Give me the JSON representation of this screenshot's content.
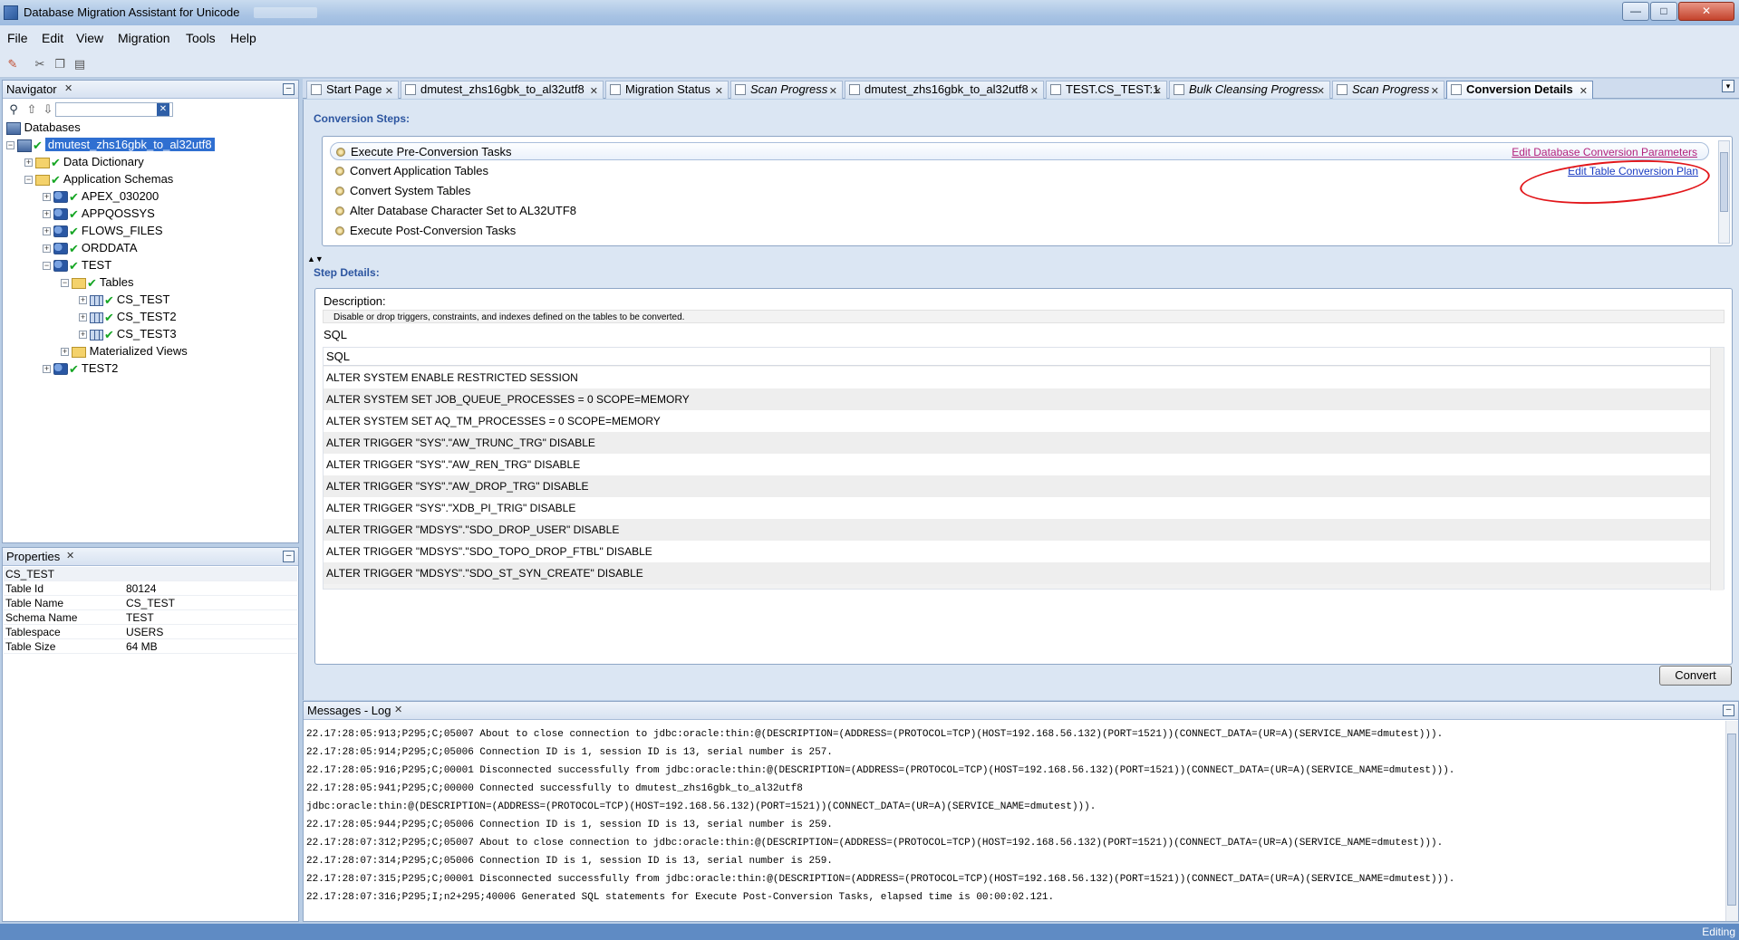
{
  "window": {
    "title": "Database Migration Assistant for Unicode",
    "minimize": "—",
    "maximize": "□",
    "close": "✕"
  },
  "menu": [
    "File",
    "Edit",
    "View",
    "Migration",
    "Tools",
    "Help"
  ],
  "navigator": {
    "title": "Navigator",
    "root": "Databases",
    "tree": [
      {
        "label": "dmutest_zhs16gbk_to_al32utf8",
        "toggle": "−",
        "selected": true
      },
      {
        "label": "Data Dictionary",
        "toggle": "+"
      },
      {
        "label": "Application Schemas",
        "toggle": "−"
      },
      {
        "label": "APEX_030200",
        "toggle": "+"
      },
      {
        "label": "APPQOSSYS",
        "toggle": "+"
      },
      {
        "label": "FLOWS_FILES",
        "toggle": "+"
      },
      {
        "label": "ORDDATA",
        "toggle": "+"
      },
      {
        "label": "TEST",
        "toggle": "−"
      },
      {
        "label": "Tables",
        "toggle": "−"
      },
      {
        "label": "CS_TEST",
        "toggle": "+"
      },
      {
        "label": "CS_TEST2",
        "toggle": "+"
      },
      {
        "label": "CS_TEST3",
        "toggle": "+"
      },
      {
        "label": "Materialized Views",
        "toggle": "+"
      },
      {
        "label": "TEST2",
        "toggle": "+"
      }
    ]
  },
  "properties": {
    "title": "Properties",
    "object": "CS_TEST",
    "rows": [
      {
        "key": "Table Id",
        "value": "80124"
      },
      {
        "key": "Table Name",
        "value": "CS_TEST"
      },
      {
        "key": "Schema Name",
        "value": "TEST"
      },
      {
        "key": "Tablespace",
        "value": "USERS"
      },
      {
        "key": "Table Size",
        "value": "64 MB"
      }
    ]
  },
  "tabs": [
    {
      "label": "Start Page"
    },
    {
      "label": "dmutest_zhs16gbk_to_al32utf8"
    },
    {
      "label": "Migration Status"
    },
    {
      "label": "Scan Progress"
    },
    {
      "label": "dmutest_zhs16gbk_to_al32utf8"
    },
    {
      "label": "TEST.CS_TEST:1"
    },
    {
      "label": "Bulk Cleansing Progress"
    },
    {
      "label": "Scan Progress"
    },
    {
      "label": "Conversion Details"
    }
  ],
  "conversion": {
    "steps_label": "Conversion Steps:",
    "steps": [
      "Execute Pre-Conversion Tasks",
      "Convert Application Tables",
      "Convert System Tables",
      "Alter Database Character Set to AL32UTF8",
      "Execute Post-Conversion Tasks"
    ],
    "link_params": "Edit Database Conversion Parameters",
    "link_plan": "Edit Table Conversion Plan",
    "details_label": "Step Details:",
    "description_label": "Description:",
    "description": "Disable or drop triggers, constraints, and indexes defined on the tables to be converted.",
    "sql_label": "SQL",
    "sql_header": "SQL",
    "sql_rows": [
      "ALTER SYSTEM ENABLE RESTRICTED SESSION",
      "ALTER SYSTEM SET JOB_QUEUE_PROCESSES = 0 SCOPE=MEMORY",
      "ALTER SYSTEM SET AQ_TM_PROCESSES = 0 SCOPE=MEMORY",
      "ALTER TRIGGER \"SYS\".\"AW_TRUNC_TRG\" DISABLE",
      "ALTER TRIGGER \"SYS\".\"AW_REN_TRG\" DISABLE",
      "ALTER TRIGGER \"SYS\".\"AW_DROP_TRG\" DISABLE",
      "ALTER TRIGGER \"SYS\".\"XDB_PI_TRIG\" DISABLE",
      "ALTER TRIGGER \"MDSYS\".\"SDO_DROP_USER\" DISABLE",
      "ALTER TRIGGER \"MDSYS\".\"SDO_TOPO_DROP_FTBL\" DISABLE",
      "ALTER TRIGGER \"MDSYS\".\"SDO_ST_SYN_CREATE\" DISABLE"
    ],
    "convert_button": "Convert"
  },
  "messages": {
    "title": "Messages - Log",
    "lines": [
      "22.17:28:05:913;P295;C;05007 About to close connection to jdbc:oracle:thin:@(DESCRIPTION=(ADDRESS=(PROTOCOL=TCP)(HOST=192.168.56.132)(PORT=1521))(CONNECT_DATA=(UR=A)(SERVICE_NAME=dmutest))).",
      "22.17:28:05:914;P295;C;05006 Connection ID is 1, session ID is 13, serial number is 257.",
      "22.17:28:05:916;P295;C;00001 Disconnected successfully from jdbc:oracle:thin:@(DESCRIPTION=(ADDRESS=(PROTOCOL=TCP)(HOST=192.168.56.132)(PORT=1521))(CONNECT_DATA=(UR=A)(SERVICE_NAME=dmutest))).",
      "22.17:28:05:941;P295;C;00000 Connected successfully to dmutest_zhs16gbk_to_al32utf8",
      "jdbc:oracle:thin:@(DESCRIPTION=(ADDRESS=(PROTOCOL=TCP)(HOST=192.168.56.132)(PORT=1521))(CONNECT_DATA=(UR=A)(SERVICE_NAME=dmutest))).",
      "22.17:28:05:944;P295;C;05006 Connection ID is 1, session ID is 13, serial number is 259.",
      "22.17:28:07:312;P295;C;05007 About to close connection to jdbc:oracle:thin:@(DESCRIPTION=(ADDRESS=(PROTOCOL=TCP)(HOST=192.168.56.132)(PORT=1521))(CONNECT_DATA=(UR=A)(SERVICE_NAME=dmutest))).",
      "22.17:28:07:314;P295;C;05006 Connection ID is 1, session ID is 13, serial number is 259.",
      "22.17:28:07:315;P295;C;00001 Disconnected successfully from jdbc:oracle:thin:@(DESCRIPTION=(ADDRESS=(PROTOCOL=TCP)(HOST=192.168.56.132)(PORT=1521))(CONNECT_DATA=(UR=A)(SERVICE_NAME=dmutest))).",
      "22.17:28:07:316;P295;I;n2+295;40006 Generated SQL statements for Execute Post-Conversion Tasks, elapsed time is 00:00:02.121."
    ]
  },
  "status": {
    "text": "Editing"
  },
  "colors": {
    "accent": "#2f6fd1",
    "link": "#1a3cc2",
    "annotation": "#e2161a"
  }
}
